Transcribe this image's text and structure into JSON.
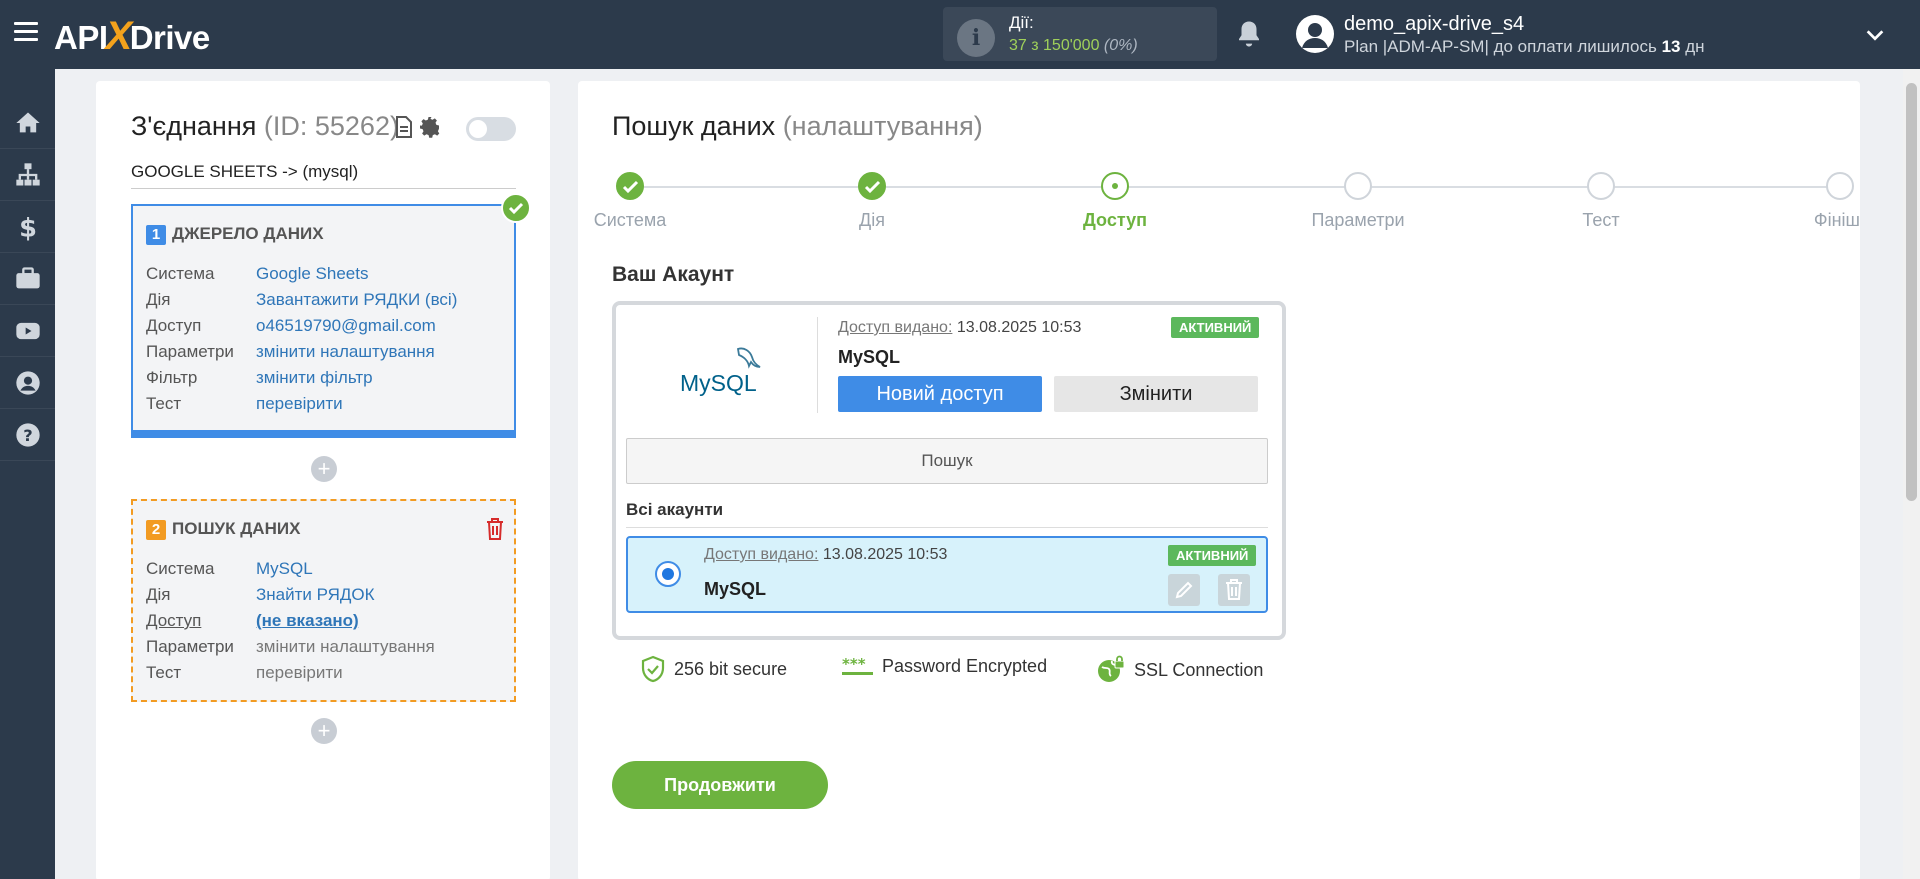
{
  "header": {
    "logo_api": "API",
    "logo_x": "X",
    "logo_drive": "Drive",
    "actions_label": "Дії:",
    "actions_count": "37 з 150'000",
    "actions_pct": "(0%)",
    "user_name": "demo_apix-drive_s4",
    "plan_prefix": "Plan |ADM-AP-SM| до оплати лишилось",
    "plan_days": "13",
    "plan_suffix": "дн"
  },
  "sidebar": {
    "icons": [
      "home-icon",
      "sitemap-icon",
      "dollar-icon",
      "briefcase-icon",
      "youtube-icon",
      "user-icon",
      "help-icon"
    ]
  },
  "connection": {
    "title": "З'єднання",
    "id_text": "(ID: 55262)",
    "subtitle": "GOOGLE SHEETS -> (mysql)",
    "source": {
      "number": "1",
      "title": "ДЖЕРЕЛО ДАНИХ",
      "rows": [
        {
          "key": "Система",
          "value": "Google Sheets"
        },
        {
          "key": "Дія",
          "value": "Завантажити РЯДКИ (всі)"
        },
        {
          "key": "Доступ",
          "value": "o46519790@gmail.com"
        },
        {
          "key": "Параметри",
          "value": "змінити налаштування"
        },
        {
          "key": "Фільтр",
          "value": "змінити фільтр"
        },
        {
          "key": "Тест",
          "value": "перевірити"
        }
      ]
    },
    "search": {
      "number": "2",
      "title": "ПОШУК ДАНИХ",
      "rows": [
        {
          "key": "Система",
          "value": "MySQL"
        },
        {
          "key": "Дія",
          "value": "Знайти РЯДОК"
        },
        {
          "key": "Доступ",
          "value": "(не вказано)"
        },
        {
          "key": "Параметри",
          "value": "змінити налаштування"
        },
        {
          "key": "Тест",
          "value": "перевірити"
        }
      ]
    },
    "plus": "+"
  },
  "main": {
    "title": "Пошук даних",
    "title_suffix": "(налаштування)",
    "steps": [
      "Система",
      "Дія",
      "Доступ",
      "Параметри",
      "Тест",
      "Фініш"
    ],
    "current_step": 2,
    "account_title": "Ваш Акаунт",
    "card": {
      "granted_label": "Доступ видано:",
      "granted_date": "13.08.2025 10:53",
      "status": "АКТИВНИЙ",
      "name": "MySQL",
      "btn_new": "Новий доступ",
      "btn_change": "Змінити",
      "logo_text": "MySQL"
    },
    "search_label": "Пошук",
    "all_accounts": "Всі акаунти",
    "account_row": {
      "granted_label": "Доступ видано:",
      "granted_date": "13.08.2025 10:53",
      "status": "АКТИВНИЙ",
      "name": "MySQL"
    },
    "security": [
      "256 bit secure",
      "Password Encrypted",
      "SSL Connection"
    ],
    "continue": "Продовжити"
  },
  "colors": {
    "topbar": "#2c3a4b",
    "accent_blue": "#3f8ce6",
    "accent_green": "#6db33f",
    "accent_orange": "#f29b22"
  }
}
